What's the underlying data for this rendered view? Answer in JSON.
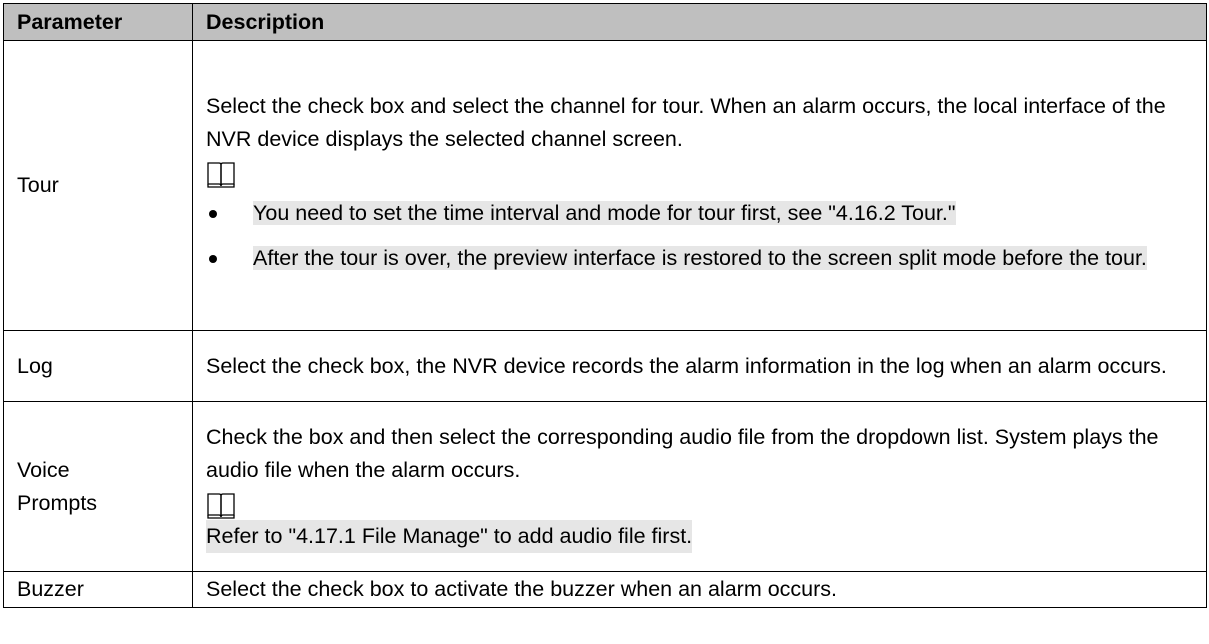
{
  "table": {
    "header": {
      "parameter": "Parameter",
      "description": "Description"
    },
    "rows": [
      {
        "parameter": "Tour",
        "description": "Select the check box and select the channel for tour. When an alarm occurs, the local interface of the NVR device displays the selected channel screen.",
        "note_icon": "book-note-icon",
        "bullets": [
          "You need to set the time interval and mode for tour first, see \"4.16.2 Tour.\"",
          "After the tour is over, the preview interface is restored to the screen split mode before the tour."
        ]
      },
      {
        "parameter": "Log",
        "description": "Select the check box, the NVR device records the alarm information in the log when an alarm occurs."
      },
      {
        "parameter": "Voice Prompts",
        "description": "Check the box and then select the corresponding audio file from the dropdown list. System plays the audio file when the alarm occurs.",
        "note_icon": "book-note-icon",
        "note": "Refer to \"4.17.1 File Manage\" to add audio file first."
      },
      {
        "parameter": "Buzzer",
        "description": "Select the check box to activate the buzzer when an alarm occurs."
      }
    ]
  }
}
